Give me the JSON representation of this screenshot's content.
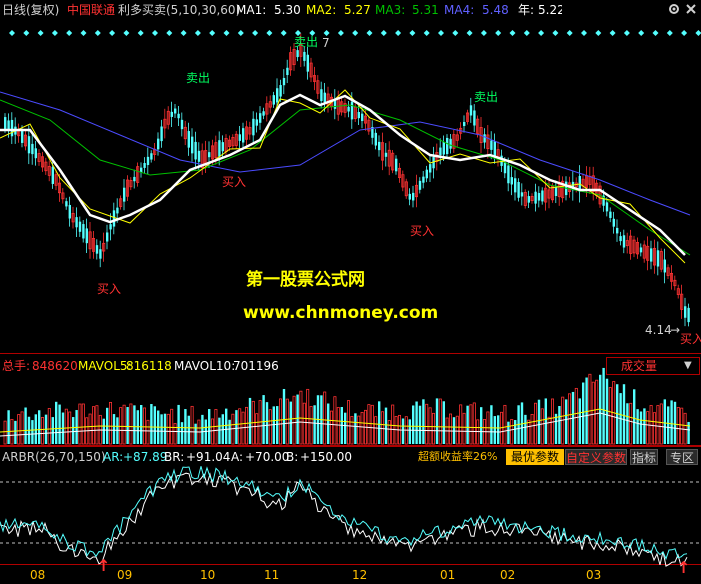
{
  "colors": {
    "background": "#000000",
    "up": "#ff3232",
    "down": "#54ffff",
    "ma1": "#ffffff",
    "ma2": "#ffff00",
    "ma3": "#00c000",
    "ma4": "#4b4bff",
    "frame": "#b00000",
    "accent_yellow": "#ffc000",
    "watermark": "#ffff00"
  },
  "price_panel": {
    "period": "日线(复权)",
    "stock_name": "中国联通",
    "indicator": "利多买卖(5,10,30,60)",
    "ma1_label": "MA1:",
    "ma1_value": "5.30",
    "ma2_label": "MA2:",
    "ma2_value": "5.27",
    "ma3_label": "MA3:",
    "ma3_value": "5.31",
    "ma4_label": "MA4:",
    "ma4_value": "5.48",
    "year_label": "年:",
    "year_value": "5.22",
    "sell_signal_label": "卖出",
    "sell_signal_top_label": "卖出",
    "buy_signal_label": "买入",
    "high_price": "7",
    "low_price": "4.14",
    "low_arrow": "→"
  },
  "watermark": {
    "title": "第一股票公式网",
    "url": "www.chnmoney.com"
  },
  "volume_panel": {
    "total_label": "总手:",
    "total_value": "848620",
    "mavol5_label": "MAVOL5:",
    "mavol5_value": "816118",
    "mavol10_label": "MAVOL10:",
    "mavol10_value": "701196",
    "dropdown_label": "成交量",
    "dropdown_arrow": "▼"
  },
  "indicator_panel": {
    "name": "ARBR(26,70,150)",
    "ar_label": "AR:",
    "ar_value": "+87.89",
    "br_label": "BR:",
    "br_value": "+91.04",
    "a_label": "A:",
    "a_value": "+70.00",
    "b_label": "B:",
    "b_value": "+150.00",
    "excess_label": "超额收益率26%",
    "tabs": [
      "最优参数",
      "自定义参数",
      "指标",
      "专区"
    ],
    "arrow_up": "↑"
  },
  "x_axis": {
    "months": [
      "08",
      "09",
      "10",
      "11",
      "12",
      "01",
      "02",
      "03"
    ]
  },
  "toolbar": {
    "settings_icon": "gear-icon",
    "close_icon": "close-icon"
  }
}
